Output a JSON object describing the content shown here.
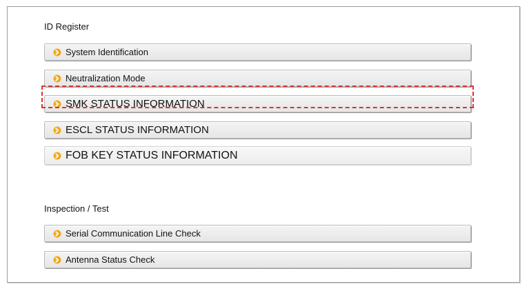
{
  "sections": [
    {
      "title": "ID Register",
      "items": [
        {
          "label": "System Identification"
        },
        {
          "label": "Neutralization Mode"
        },
        {
          "label": "SMK STATUS INFORMATION"
        },
        {
          "label": "ESCL STATUS INFORMATION"
        },
        {
          "label": "FOB KEY STATUS INFORMATION"
        }
      ]
    },
    {
      "title": "Inspection / Test",
      "items": [
        {
          "label": "Serial Communication Line Check"
        },
        {
          "label": "Antenna Status Check"
        }
      ]
    }
  ],
  "colors": {
    "icon_orange": "#f2a81d",
    "highlight_red": "#e03030"
  },
  "icons": {
    "menu_item": "arrow-right-circle-icon"
  }
}
